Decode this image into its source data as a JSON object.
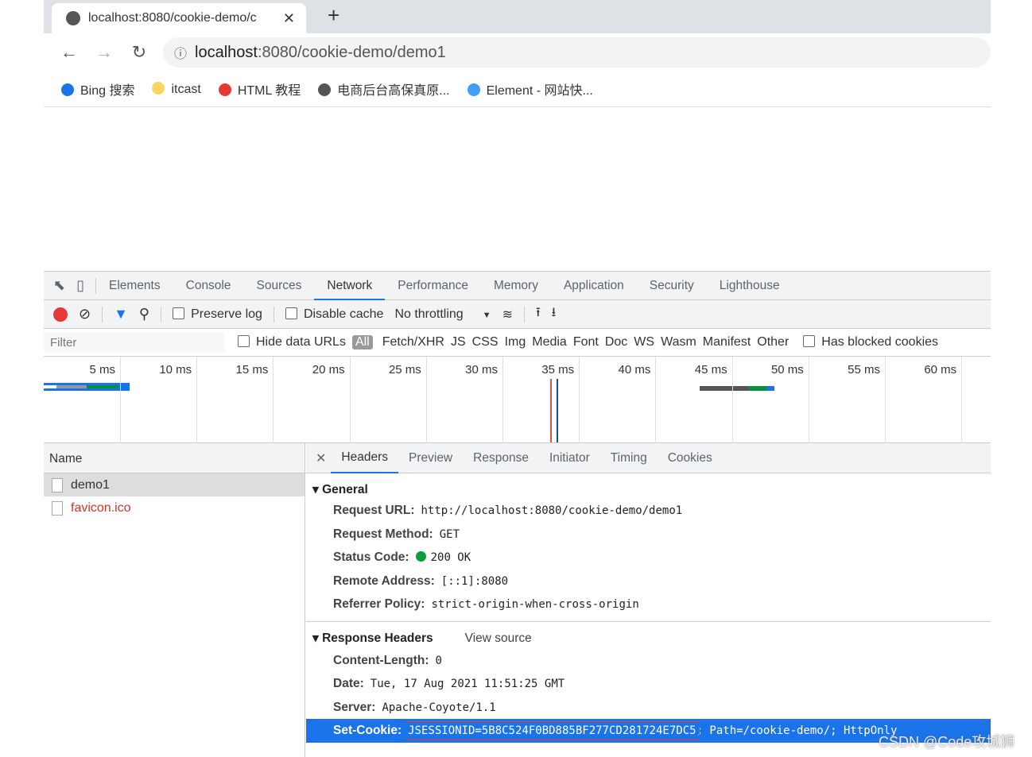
{
  "browser": {
    "tab_title": "localhost:8080/cookie-demo/c",
    "url_host": "localhost",
    "url_rest": ":8080/cookie-demo/demo1",
    "bookmarks": [
      {
        "label": "Bing 搜索",
        "color": "#1a73e8"
      },
      {
        "label": "itcast",
        "color": "#f9d65c"
      },
      {
        "label": "HTML 教程",
        "color": "#e53935"
      },
      {
        "label": "电商后台高保真原...",
        "color": "#555555"
      },
      {
        "label": "Element - 网站快...",
        "color": "#409eff"
      }
    ]
  },
  "devtools": {
    "tabs": [
      "Elements",
      "Console",
      "Sources",
      "Network",
      "Performance",
      "Memory",
      "Application",
      "Security",
      "Lighthouse"
    ],
    "active_tab": "Network",
    "toolbar": {
      "preserve_log": "Preserve log",
      "disable_cache": "Disable cache",
      "throttling": "No throttling"
    },
    "filter": {
      "placeholder": "Filter",
      "hide_data_urls": "Hide data URLs",
      "types": [
        "All",
        "Fetch/XHR",
        "JS",
        "CSS",
        "Img",
        "Media",
        "Font",
        "Doc",
        "WS",
        "Wasm",
        "Manifest",
        "Other"
      ],
      "has_blocked": "Has blocked cookies"
    },
    "timeline": [
      "5 ms",
      "10 ms",
      "15 ms",
      "20 ms",
      "25 ms",
      "30 ms",
      "35 ms",
      "40 ms",
      "45 ms",
      "50 ms",
      "55 ms",
      "60 ms"
    ],
    "requests": {
      "header": "Name",
      "items": [
        {
          "name": "demo1",
          "color": "#333"
        },
        {
          "name": "favicon.ico",
          "color": "#d93025"
        }
      ]
    },
    "detail": {
      "tabs": [
        "Headers",
        "Preview",
        "Response",
        "Initiator",
        "Timing",
        "Cookies"
      ],
      "general_title": "General",
      "general": [
        {
          "k": "Request URL:",
          "v": "http://localhost:8080/cookie-demo/demo1"
        },
        {
          "k": "Request Method:",
          "v": "GET"
        },
        {
          "k": "Status Code:",
          "v": "200 OK"
        },
        {
          "k": "Remote Address:",
          "v": "[::1]:8080"
        },
        {
          "k": "Referrer Policy:",
          "v": "strict-origin-when-cross-origin"
        }
      ],
      "response_title": "Response Headers",
      "view_source": "View source",
      "response": [
        {
          "k": "Content-Length:",
          "v": "0"
        },
        {
          "k": "Date:",
          "v": "Tue, 17 Aug 2021 11:51:25 GMT"
        },
        {
          "k": "Server:",
          "v": "Apache-Coyote/1.1"
        }
      ],
      "set_cookie": {
        "k": "Set-Cookie:",
        "v1": "JSESSIONID=5B8C524F0BD885BF277CD281724E7DC5",
        "v2": "; Path=/cookie-demo/; HttpOnly"
      }
    }
  },
  "watermark": "CSDN @Code攻城狮"
}
